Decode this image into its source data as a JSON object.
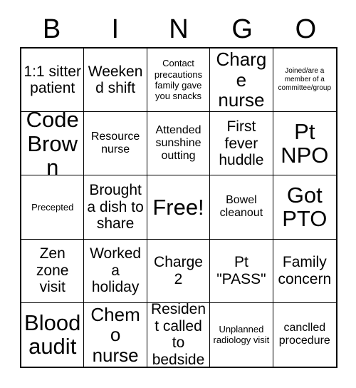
{
  "header": {
    "letters": [
      "B",
      "I",
      "N",
      "G",
      "O"
    ]
  },
  "grid": {
    "columns": 5,
    "rows": 5,
    "cells": [
      {
        "text": "1:1 sitter patient",
        "size": "t-lg"
      },
      {
        "text": "Weekend shift",
        "size": "t-lg"
      },
      {
        "text": "Contact precautions family gave you snacks",
        "size": "t-sm"
      },
      {
        "text": "Charge nurse",
        "size": "t-xl"
      },
      {
        "text": "Joined/are a member of a committee/group",
        "size": "t-xs"
      },
      {
        "text": "Code Brown",
        "size": "t-xxl"
      },
      {
        "text": "Resource nurse",
        "size": "t-md"
      },
      {
        "text": "Attended sunshine outting",
        "size": "t-md"
      },
      {
        "text": "First fever huddle",
        "size": "t-lg"
      },
      {
        "text": "Pt NPO",
        "size": "t-xxl"
      },
      {
        "text": "Precepted",
        "size": "t-sm"
      },
      {
        "text": "Brought a dish to share",
        "size": "t-lg"
      },
      {
        "text": "Free!",
        "size": "t-xxl"
      },
      {
        "text": "Bowel cleanout",
        "size": "t-md"
      },
      {
        "text": "Got PTO",
        "size": "t-xxl"
      },
      {
        "text": "Zen zone visit",
        "size": "t-lg"
      },
      {
        "text": "Worked a holiday",
        "size": "t-lg"
      },
      {
        "text": "Charge 2",
        "size": "t-lg"
      },
      {
        "text": "Pt \"PASS\"",
        "size": "t-lg"
      },
      {
        "text": "Family concern",
        "size": "t-lg"
      },
      {
        "text": "Blood audit",
        "size": "t-xxl"
      },
      {
        "text": "Chemo nurse",
        "size": "t-xl"
      },
      {
        "text": "Resident called to bedside",
        "size": "t-lg"
      },
      {
        "text": "Unplanned radiology visit",
        "size": "t-sm"
      },
      {
        "text": "canclled procedure",
        "size": "t-md"
      }
    ]
  },
  "colors": {
    "background": "#ffffff",
    "text": "#000000",
    "border": "#000000"
  }
}
